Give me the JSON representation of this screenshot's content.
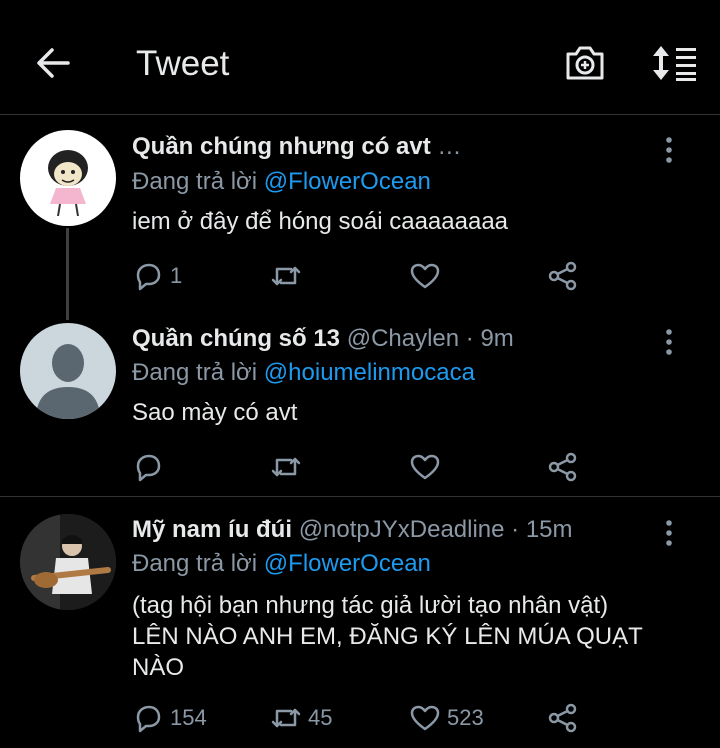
{
  "header": {
    "title": "Tweet",
    "back_icon": "arrow-left-icon",
    "camera_icon": "add-photo-icon",
    "sort_icon": "sort-icon"
  },
  "colors": {
    "background": "#000000",
    "text": "#e7e9ea",
    "muted": "#8b98a5",
    "accent": "#1d9bf0",
    "divider": "#2f3336"
  },
  "tweets": [
    {
      "name": "Quần chúng nhưng có avt",
      "handle": "…",
      "reply_prefix": "Đang trả lời",
      "reply_to": "@FlowerOcean",
      "text": "iem ở đây để hóng soái caaaaaaaa",
      "replies": "1",
      "retweets": "",
      "likes": ""
    },
    {
      "name": "Quần chúng số 13",
      "handle": "@Chaylen · 9m",
      "reply_prefix": "Đang trả lời",
      "reply_to": "@hoiumelinmocaca",
      "text": "Sao mày có avt",
      "replies": "",
      "retweets": "",
      "likes": ""
    },
    {
      "name": "Mỹ nam íu đúi",
      "handle": "@notpJYxDeadline · 15m",
      "reply_prefix": "Đang trả lời",
      "reply_to": "@FlowerOcean",
      "text_lines": [
        "(tag hội bạn nhưng tác giả lười tạo nhân vật)",
        "LÊN NÀO ANH EM, ĐĂNG KÝ LÊN MÚA QUẠT",
        "NÀO"
      ],
      "replies": "154",
      "retweets": "45",
      "likes": "523"
    }
  ]
}
